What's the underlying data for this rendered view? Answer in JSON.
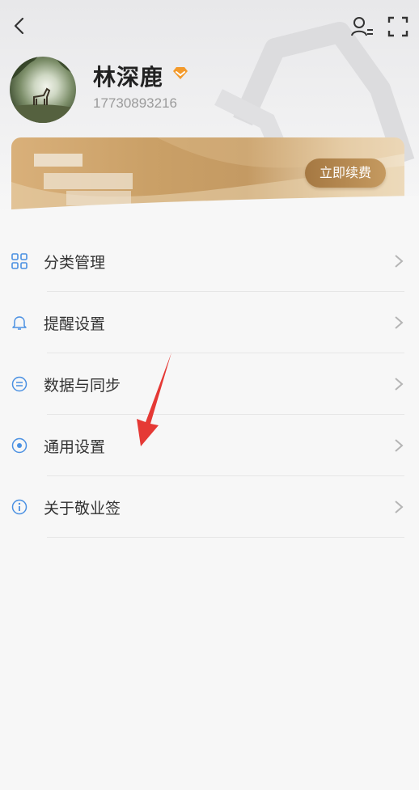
{
  "header": {
    "user_name": "林深鹿",
    "phone": "17730893216"
  },
  "vip_card": {
    "renew_label": "立即续费"
  },
  "menu": {
    "items": [
      {
        "label": "分类管理",
        "icon": "category-grid-icon"
      },
      {
        "label": "提醒设置",
        "icon": "bell-icon"
      },
      {
        "label": "数据与同步",
        "icon": "sync-icon"
      },
      {
        "label": "通用设置",
        "icon": "general-settings-icon"
      },
      {
        "label": "关于敬业签",
        "icon": "info-icon"
      }
    ]
  },
  "colors": {
    "accent_blue": "#4a90e2",
    "vip_gold": "#c49a63",
    "badge_orange": "#f39a2b",
    "annotation_red": "#e53935"
  }
}
